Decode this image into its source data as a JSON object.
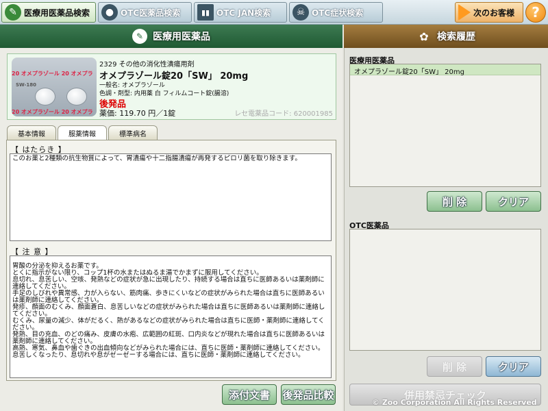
{
  "toolbar": {
    "tab_medical": "医療用医薬品検索",
    "tab_otc": "OTC医薬品検索",
    "tab_jan": "OTC JAN検索",
    "tab_symptom": "OTC症状検索",
    "next_customer": "次のお客様",
    "help": "?"
  },
  "left_header": "医療用医薬品",
  "right_header": "検索履歴",
  "drug": {
    "image_strip_text": "20 オメプラゾール 20 オメプラ",
    "image_code": "SW-180",
    "category": "2329  その他の消化性潰瘍用剤",
    "name": "オメプラゾール錠20「SW」 20mg",
    "generic_name": "一般名:  オメプラゾール",
    "appearance": "色調・剤型:  内用薬  白  フィルムコート錠(腸溶)",
    "generic_tag": "後発品",
    "price": "薬価:  119.70 円／1錠",
    "receipt_code": "レセ電薬品コード:  620001985"
  },
  "tabs": [
    "基本情報",
    "服薬情報",
    "標準病名"
  ],
  "action": {
    "label": "【  はたらき  】",
    "text": "このお薬と2種類の抗生物質によって、胃潰瘍や十二指腸潰瘍が再発するピロリ菌を取り除きます。"
  },
  "caution": {
    "label": "【  注    意  】",
    "lines": [
      "胃酸の分泌を抑えるお薬です。",
      "とくに指示がない限り、コップ1杯の水またはぬるま湯でかまずに服用してください。",
      "息切れ、息苦しい、空咳、発熱などの症状が急に出現したり、持続する場合は直ちに医師あるいは薬剤師に連絡してください。",
      "手足のしびれや異常感、力が入らない、筋肉痛、歩きにくいなどの症状がみられた場合は直ちに医師あるいは薬剤師に連絡してください。",
      "発疹、顔面のむくみ、顔面蒼白、息苦しいなどの症状がみられた場合は直ちに医師あるいは薬剤師に連絡してください。",
      "むくみ、尿量の減少、体がだるく、熱があるなどの症状がみられた場合は直ちに医師・薬剤師に連絡してください。",
      "発熱、目の充血、のどの痛み、皮膚の水疱、広範囲の紅斑、口内炎などが現れた場合は直ちに医師あるいは薬剤師に連絡してください。",
      "高熱、寒気、鼻血や歯ぐきの出血傾向などがみられた場合には、直ちに医師・薬剤師に連絡してください。",
      "息苦しくなったり、息切れや息がゼーゼーする場合には、直ちに医師・薬剤師に連絡してください。"
    ]
  },
  "buttons": {
    "attached_doc": "添付文書",
    "generic_compare": "後発品比較",
    "delete": "削 除",
    "clear": "クリア",
    "interaction_check": "併用禁忌チェック"
  },
  "history": {
    "medical_label": "医療用医薬品",
    "medical_items": [
      "オメプラゾール錠20「SW」 20mg"
    ],
    "otc_label": "OTC医薬品"
  },
  "copyright": "© Zoo Corporation All Rights Reserved",
  "colors": {
    "left_header": "#1f5a33",
    "right_header": "#6e4e1e",
    "generic_tag": "#dd0000"
  }
}
